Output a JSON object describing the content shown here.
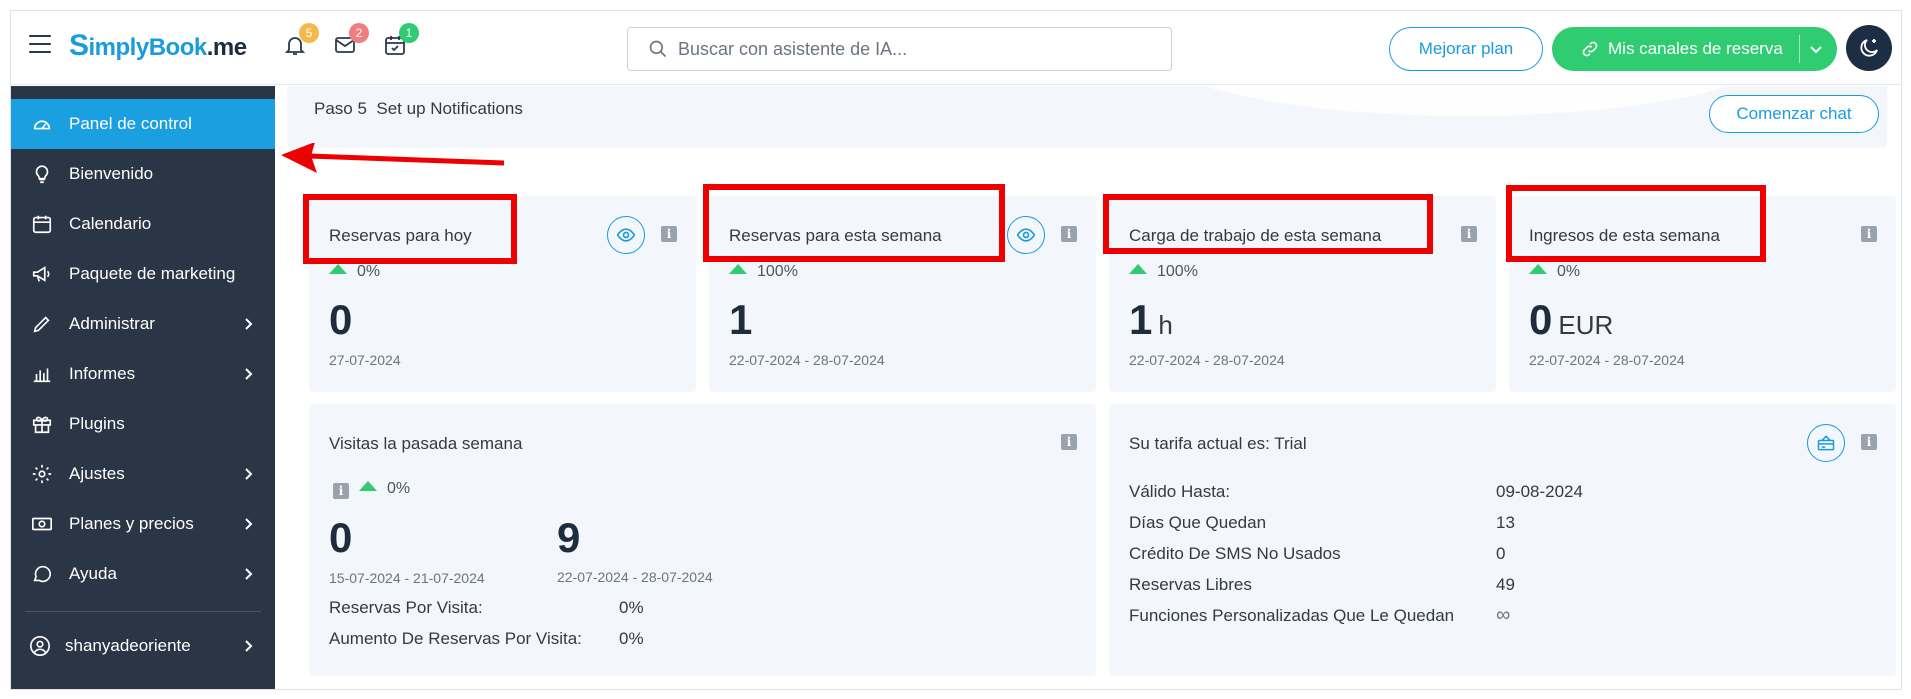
{
  "header": {
    "logo_main": "implyBook",
    "logo_s": "S",
    "logo_suffix": ".me",
    "notifications": [
      {
        "icon": "bell-icon",
        "count": "5",
        "color": "#f5b94b"
      },
      {
        "icon": "mail-icon",
        "count": "2",
        "color": "#ef7f7f"
      },
      {
        "icon": "calendar-check-icon",
        "count": "1",
        "color": "#2fcc71"
      }
    ],
    "search_placeholder": "Buscar con asistente de IA...",
    "upgrade_label": "Mejorar plan",
    "channels_label": "Mis canales de reserva"
  },
  "sidebar": {
    "items": [
      {
        "label": "Panel de control",
        "icon": "dashboard-icon",
        "active": true,
        "has_arrow": false
      },
      {
        "label": "Bienvenido",
        "icon": "lightbulb-icon",
        "active": false,
        "has_arrow": false
      },
      {
        "label": "Calendario",
        "icon": "calendar-icon",
        "active": false,
        "has_arrow": false
      },
      {
        "label": "Paquete de marketing",
        "icon": "megaphone-icon",
        "active": false,
        "has_arrow": false
      },
      {
        "label": "Administrar",
        "icon": "pencil-icon",
        "active": false,
        "has_arrow": true
      },
      {
        "label": "Informes",
        "icon": "bar-chart-icon",
        "active": false,
        "has_arrow": true
      },
      {
        "label": "Plugins",
        "icon": "gift-box-icon",
        "active": false,
        "has_arrow": false
      },
      {
        "label": "Ajustes",
        "icon": "gear-icon",
        "active": false,
        "has_arrow": true
      },
      {
        "label": "Planes y precios",
        "icon": "money-icon",
        "active": false,
        "has_arrow": true
      },
      {
        "label": "Ayuda",
        "icon": "chat-bubble-icon",
        "active": false,
        "has_arrow": true
      }
    ],
    "user": {
      "label": "shanyadeoriente",
      "icon": "user-circle-icon"
    }
  },
  "banner": {
    "step": "Paso 5",
    "step_text": "Set up Notifications",
    "chat_button": "Comenzar chat"
  },
  "stats": [
    {
      "title": "Reservas para hoy",
      "trend": "0%",
      "value": "0",
      "unit": "",
      "date": "27-07-2024",
      "has_eye": true
    },
    {
      "title": "Reservas para esta semana",
      "trend": "100%",
      "value": "1",
      "unit": "",
      "date": "22-07-2024 - 28-07-2024",
      "has_eye": true
    },
    {
      "title": "Carga de trabajo de esta semana",
      "trend": "100%",
      "value": "1",
      "unit": "h",
      "date": "22-07-2024 - 28-07-2024",
      "has_eye": false
    },
    {
      "title": "Ingresos de esta semana",
      "trend": "0%",
      "value": "0",
      "unit": "EUR",
      "date": "22-07-2024 - 28-07-2024",
      "has_eye": false
    }
  ],
  "visits": {
    "title": "Visitas la pasada semana",
    "trend": "0%",
    "prev_value": "0",
    "prev_date": "15-07-2024 - 21-07-2024",
    "curr_value": "9",
    "curr_date": "22-07-2024 - 28-07-2024",
    "rows": [
      {
        "label": "Reservas Por Visita:",
        "value": "0%"
      },
      {
        "label": "Aumento De Reservas Por Visita:",
        "value": "0%"
      }
    ]
  },
  "tariff": {
    "title": "Su tarifa actual es: Trial",
    "rows": [
      {
        "label": "Válido Hasta:",
        "value": "09-08-2024"
      },
      {
        "label": "Días Que Quedan",
        "value": "13"
      },
      {
        "label": "Crédito De SMS No Usados",
        "value": "0"
      },
      {
        "label": "Reservas Libres",
        "value": "49"
      },
      {
        "label": "Funciones Personalizadas Que Le Quedan",
        "value": "∞"
      }
    ]
  },
  "colors": {
    "accent": "#1a9bdc",
    "sidebar_bg": "#2a3546",
    "active_item": "#1a9fe0",
    "green": "#2fcc71",
    "highlight_red": "#ee0000"
  }
}
